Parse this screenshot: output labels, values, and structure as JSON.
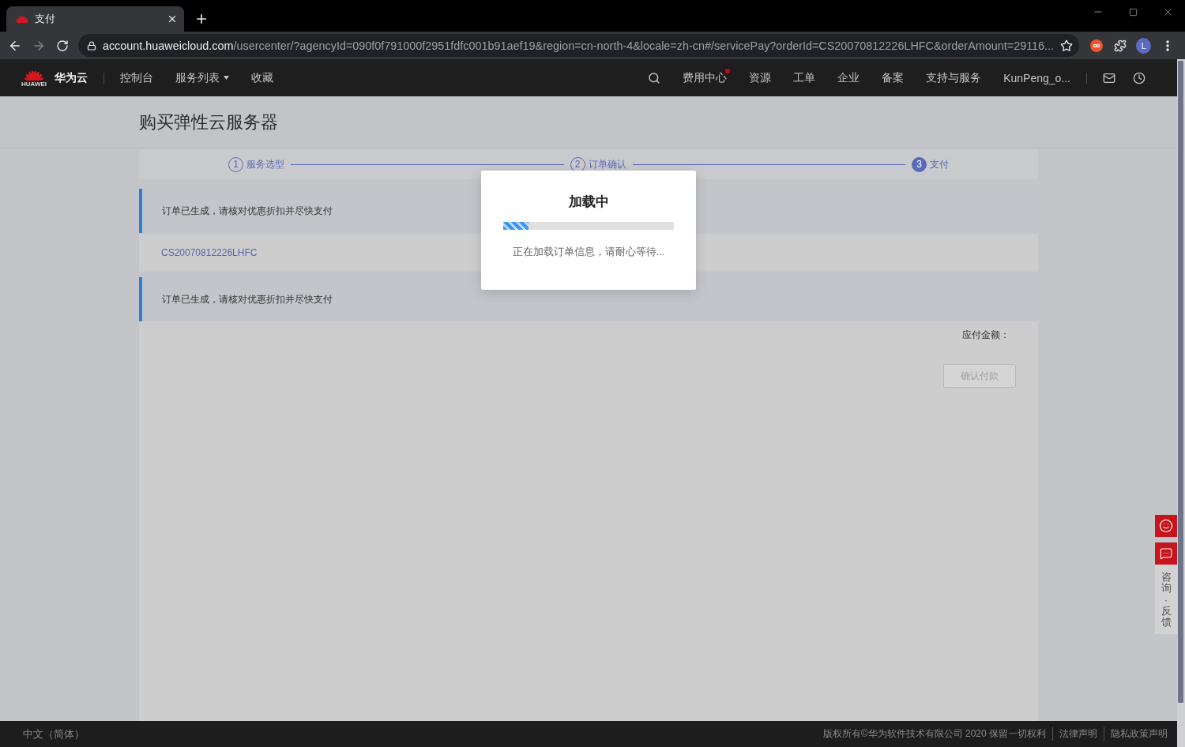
{
  "browser": {
    "tab": {
      "title": "支付"
    },
    "url": {
      "host": "account.huaweicloud.com",
      "path": "/usercenter/?agencyId=090f0f791000f2951fdfc001b91aef19&region=cn-north-4&locale=zh-cn#/servicePay?orderId=CS20070812226LHFC&orderAmount=29116..."
    },
    "profile_initial": "L"
  },
  "nav": {
    "logo_text": "HUAWEI",
    "brand": "华为云",
    "left_items": [
      {
        "label": "控制台",
        "dropdown": false
      },
      {
        "label": "服务列表",
        "dropdown": true
      },
      {
        "label": "收藏",
        "dropdown": false
      }
    ],
    "right_items": [
      {
        "label": "费用中心",
        "badge": true
      },
      {
        "label": "资源",
        "badge": false
      },
      {
        "label": "工单",
        "badge": false
      },
      {
        "label": "企业",
        "badge": false
      },
      {
        "label": "备案",
        "badge": false
      },
      {
        "label": "支持与服务",
        "badge": false
      }
    ],
    "user": "KunPeng_o..."
  },
  "page": {
    "title": "购买弹性云服务器"
  },
  "steps": [
    {
      "number": "1",
      "label": "服务选型",
      "selected": false
    },
    {
      "number": "2",
      "label": "订单确认",
      "selected": false
    },
    {
      "number": "3",
      "label": "支付",
      "selected": true
    }
  ],
  "blocks": [
    {
      "kind": "notice",
      "text": "订单已生成，请核对优惠折扣并尽快支付"
    },
    {
      "kind": "order_id",
      "text": "CS20070812226LHFC"
    },
    {
      "kind": "notice",
      "text": "订单已生成，请核对优惠折扣并尽快支付"
    }
  ],
  "payment": {
    "amount_label": "应付金额：",
    "button": {
      "label": "确认付款",
      "disabled": true
    }
  },
  "modal": {
    "title": "加载中",
    "level": 0.15,
    "message": "正在加载订单信息，请耐心等待..."
  },
  "float_buttons": [
    {
      "kind": "smiley"
    },
    {
      "kind": "feedback",
      "label": "咨询·反馈"
    }
  ],
  "footer": {
    "language": "中文（简体）",
    "copyright": "版权所有©华为软件技术有限公司 2020 保留一切权利",
    "links": [
      "法律声明",
      "隐私政策声明"
    ]
  }
}
